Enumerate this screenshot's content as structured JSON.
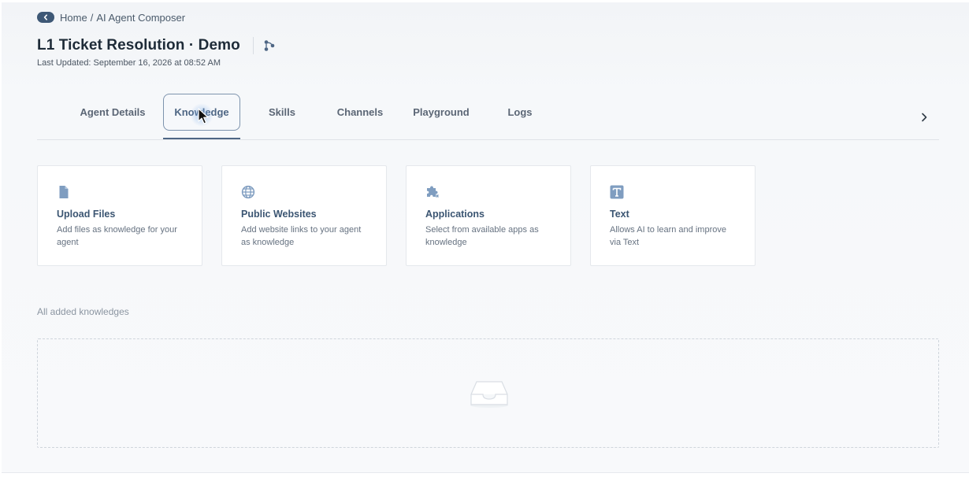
{
  "breadcrumb": {
    "home": "Home",
    "separator": "/",
    "current": "AI Agent Composer"
  },
  "header": {
    "title": "L1 Ticket Resolution · Demo",
    "last_updated": "Last Updated: September 16, 2026 at 08:52 AM",
    "back_icon": "chevron-left-icon",
    "flow_icon": "flow-icon"
  },
  "tabs": [
    {
      "label": "Agent Details",
      "active": false
    },
    {
      "label": "Knowledge",
      "active": true
    },
    {
      "label": "Skills",
      "active": false
    },
    {
      "label": "Channels",
      "active": false
    },
    {
      "label": "Playground",
      "active": false
    },
    {
      "label": "Logs",
      "active": false
    }
  ],
  "cards": [
    {
      "title": "Upload Files",
      "description": "Add files as knowledge for your agent",
      "icon": "file-icon"
    },
    {
      "title": "Public Websites",
      "description": "Add website links to your agent as knowledge",
      "icon": "globe-icon"
    },
    {
      "title": "Applications",
      "description": "Select from available apps as knowledge",
      "icon": "puzzle-icon"
    },
    {
      "title": "Text",
      "description": "Allows AI to learn and improve via Text",
      "icon": "text-icon"
    }
  ],
  "knowledge_list": {
    "label": "All added knowledges",
    "empty_icon": "inbox-icon"
  },
  "colors": {
    "accent": "#4e6684",
    "icon": "#7f9dc0",
    "back_button": "#3e5876"
  }
}
